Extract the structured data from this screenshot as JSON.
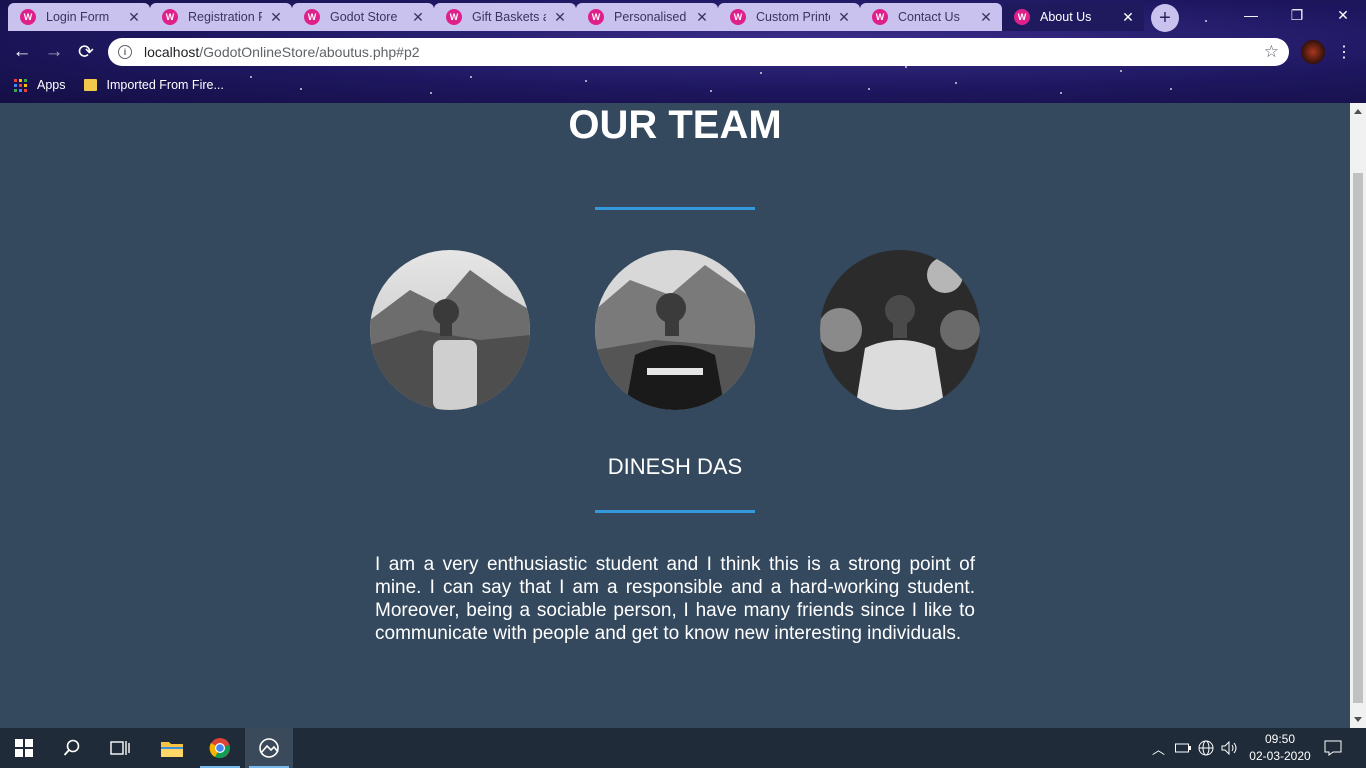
{
  "browser": {
    "tabs": [
      {
        "title": "Login Form"
      },
      {
        "title": "Registration Fo"
      },
      {
        "title": "Godot Store"
      },
      {
        "title": "Gift Baskets an"
      },
      {
        "title": "Personalised G"
      },
      {
        "title": "Custom Printe"
      },
      {
        "title": "Contact Us"
      },
      {
        "title": "About Us",
        "active": true
      }
    ],
    "url_host": "localhost",
    "url_path": "/GodotOnlineStore/aboutus.php#p2",
    "bookmarks": [
      {
        "label": "Apps",
        "icon": "apps-grid-icon"
      },
      {
        "label": "Imported From Fire...",
        "icon": "folder-icon"
      }
    ]
  },
  "page": {
    "title": "OUR TEAM",
    "member_name": "DINESH DAS",
    "bio": "I am a very enthusiastic student and I think this is a strong point of mine. I can say that I am a responsible and a hard-working student. Moreover, being a sociable person, I have many friends since I like to communicate with people and get to know new interesting individuals.",
    "accent_color": "#3498db",
    "background_color": "#34495e"
  },
  "taskbar": {
    "time": "09:50",
    "date": "02-03-2020"
  }
}
